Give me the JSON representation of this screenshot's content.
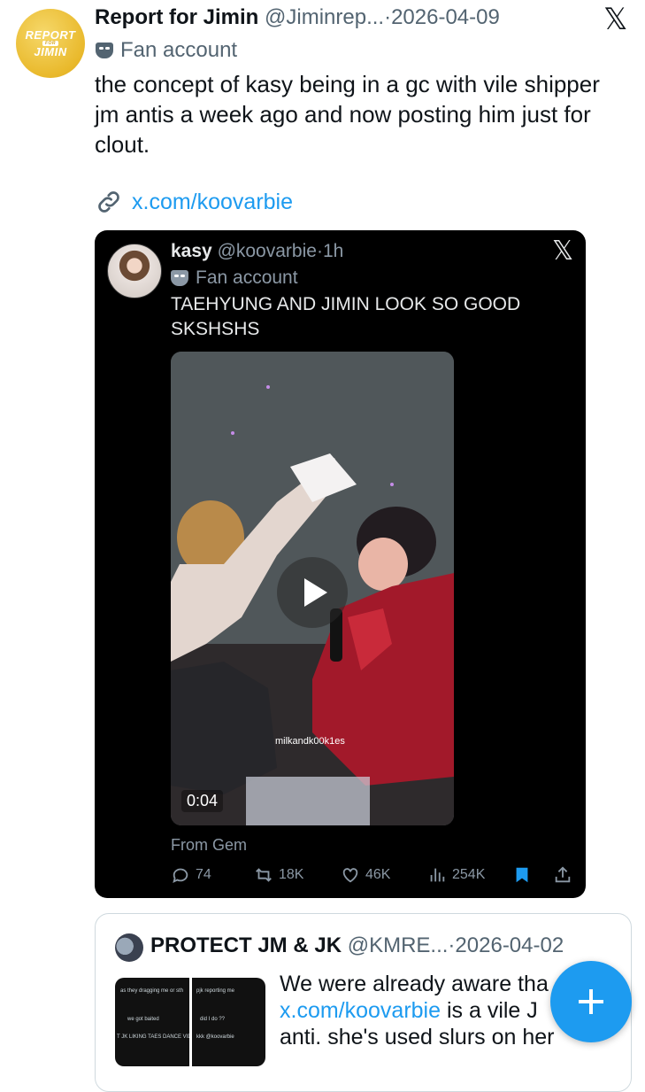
{
  "post": {
    "avatar_text_main": "REPORT",
    "avatar_text_small": "FOR",
    "avatar_text_sub": "JIMIN",
    "author_name": "Report for Jimin",
    "handle": "@Jiminrep...",
    "separator": "·",
    "date": "2026-04-09",
    "platform_logo": "𝕏",
    "label": "Fan account",
    "text": "the concept of kasy being in a gc with vile shipper jm antis a week ago and now posting him just for clout.",
    "link": "x.com/koovarbie"
  },
  "embedded": {
    "author_name": "kasy",
    "handle": "@koovarbie",
    "separator": "·",
    "time": "1h",
    "platform_logo": "𝕏",
    "label": "Fan account",
    "text": "TAEHYUNG AND JIMIN LOOK SO GOOD SKSHSHS",
    "video_watermark": "milkandk00k1es",
    "video_duration": "0:04",
    "source": "From Gem",
    "actions": {
      "replies": "74",
      "reposts": "18K",
      "likes": "46K",
      "views": "254K"
    }
  },
  "quoted": {
    "author_name": "PROTECT JM & JK",
    "handle": "@KMRE...",
    "separator": "·",
    "date": "2026-04-02",
    "text_before": "We were already aware tha",
    "link": "x.com/koovarbie",
    "text_after": " is a vile J",
    "text_line3": "anti. she's used slurs on her",
    "thumb_lines": [
      "as they dragging me or sth",
      "we got baited",
      "T JK LIKING TAES DANCE VID",
      "pjk reporting me",
      "did I do ??",
      "kkk @koovarbie"
    ]
  },
  "colors": {
    "accent": "#1d9bf0",
    "card_bg": "#000000",
    "muted": "#536471"
  }
}
